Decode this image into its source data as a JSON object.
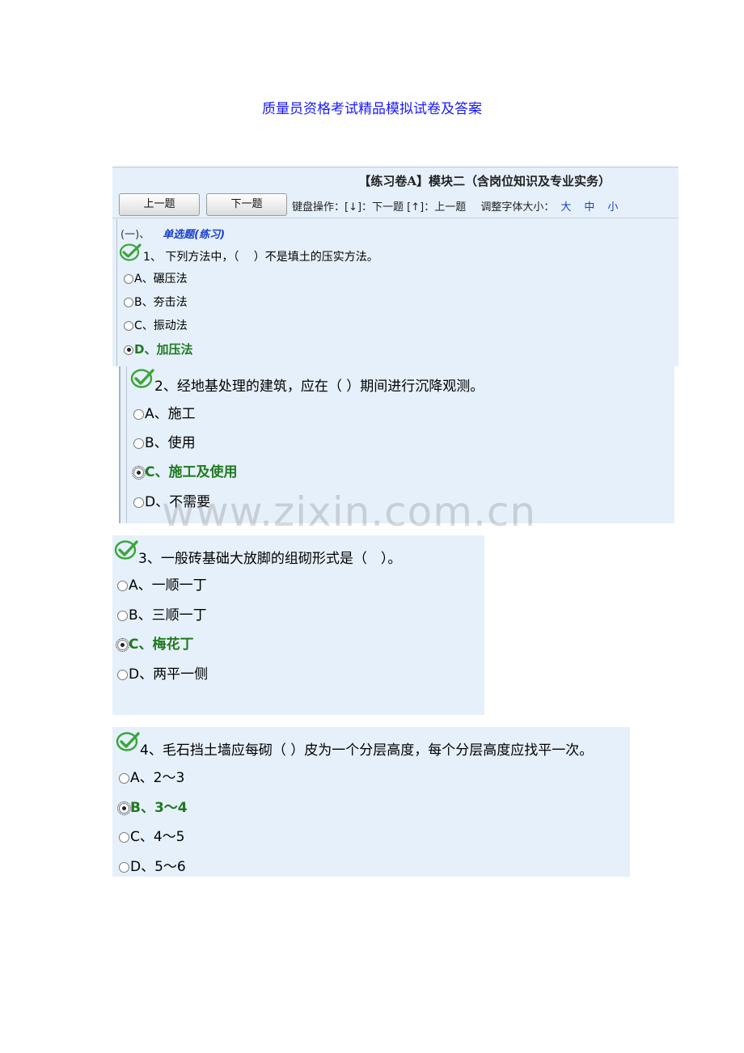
{
  "doc_title": "质量员资格考试精品模拟试卷及答案",
  "header": {
    "title": "【练习卷A】模块二（含岗位知识及专业实务）",
    "prev_button": "上一题",
    "next_button": "下一题",
    "keyboard_hint": "键盘操作：[↓]：下一题 [↑]：上一题",
    "font_size_label": "调整字体大小：",
    "font_sizes": [
      "大",
      "中",
      "小"
    ]
  },
  "section": {
    "number": "(一)、",
    "type": "单选题(练习)"
  },
  "questions": [
    {
      "stem": "1、 下列方法中，（　 ）不是填土的压实方法。",
      "options": [
        "A、碾压法",
        "B、夯击法",
        "C、振动法",
        "D、加压法"
      ],
      "selected": 3
    },
    {
      "stem": "2、经地基处理的建筑，应在（ ）期间进行沉降观测。",
      "options": [
        "A、施工",
        "B、使用",
        "C、施工及使用",
        "D、不需要"
      ],
      "selected": 2
    },
    {
      "stem": "3、一般砖基础大放脚的组砌形式是（　）。",
      "options": [
        "A、一顺一丁",
        "B、三顺一丁",
        "C、梅花丁",
        "D、两平一侧"
      ],
      "selected": 2
    },
    {
      "stem": "4、毛石挡土墙应每砌（ ）皮为一个分层高度，每个分层高度应找平一次。",
      "options": [
        "A、2～3",
        "B、3～4",
        "C、4～5",
        "D、5～6"
      ],
      "selected": 1
    }
  ],
  "watermark": "www.zixin.com.cn",
  "colors": {
    "title_blue": "#1a1aff",
    "panel_bg": "#e6f0fa",
    "selected_green": "#1f7a1f",
    "check_green": "#3aa53a"
  },
  "icons": {
    "correct": "check-circle-icon",
    "option": "radio-icon"
  }
}
